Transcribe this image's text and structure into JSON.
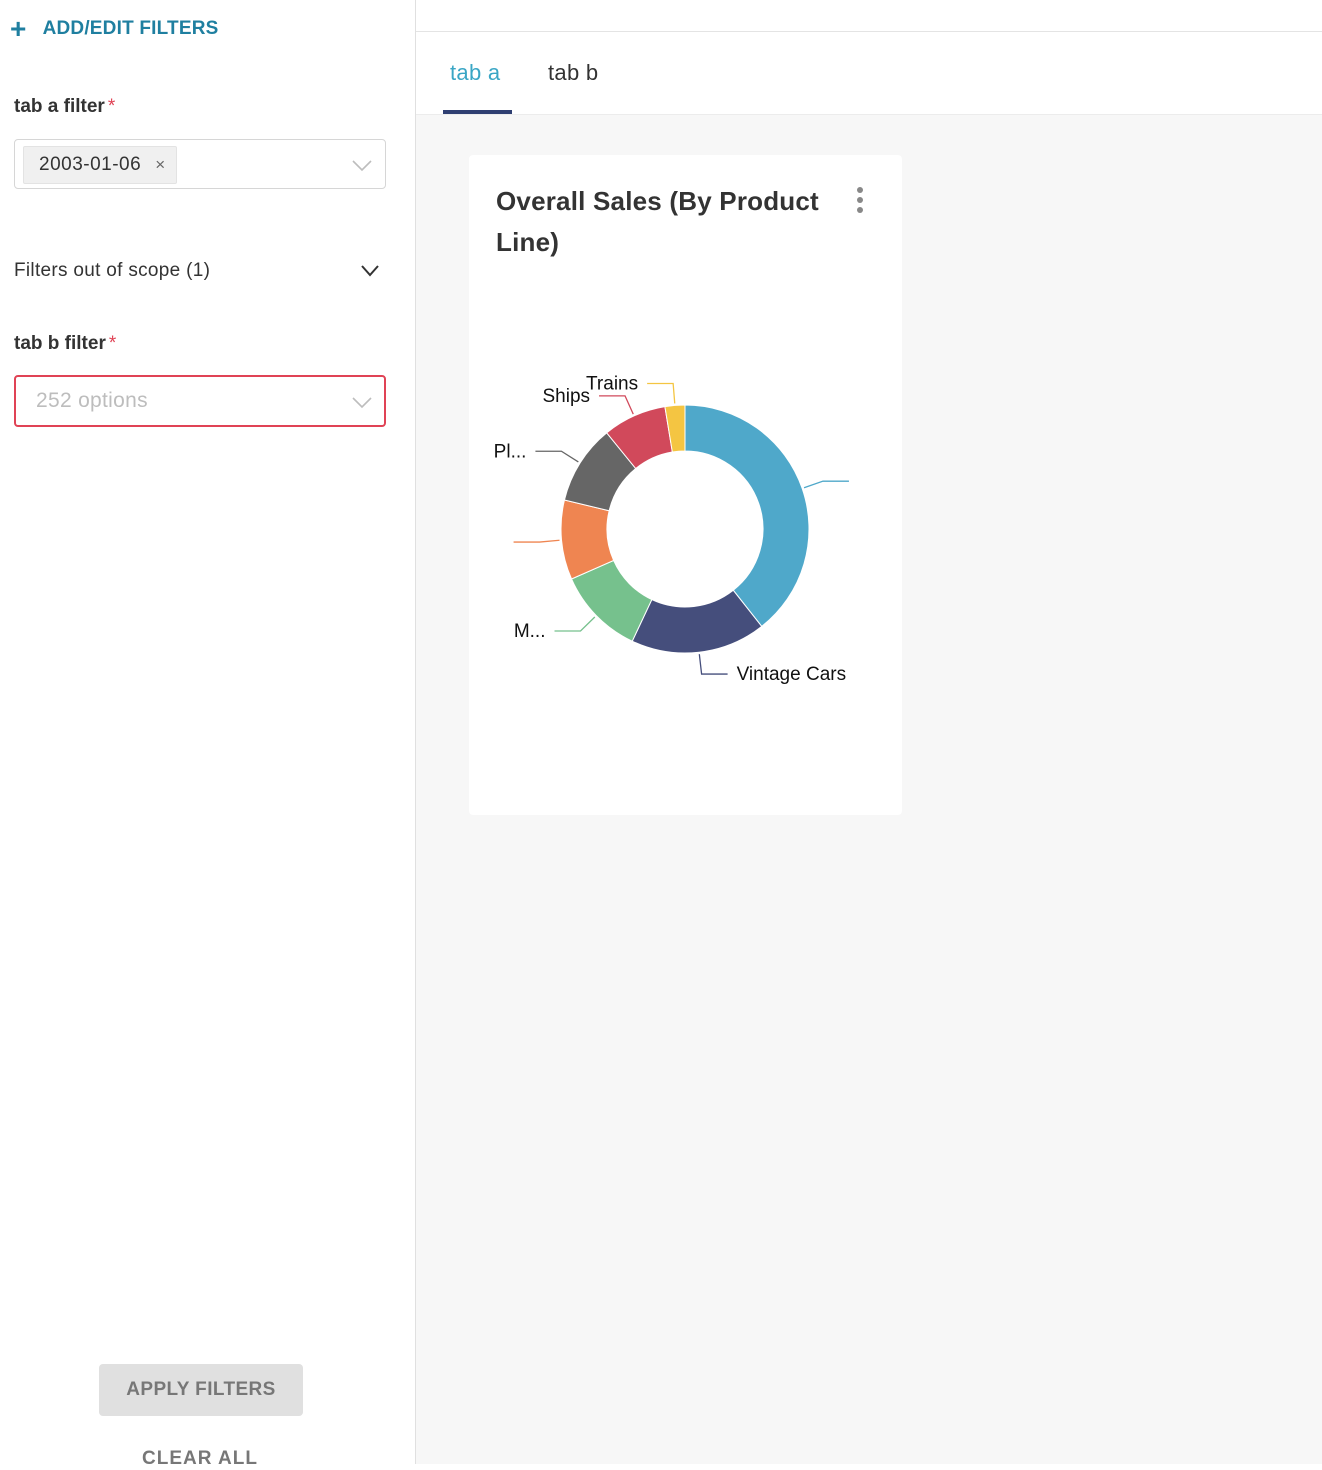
{
  "filter_panel": {
    "add_edit_label": "ADD/EDIT FILTERS",
    "tab_a_filter": {
      "label": "tab a filter",
      "required_mark": "*",
      "selected_tag": "2003-01-06",
      "remove_glyph": "×"
    },
    "scope": {
      "label": "Filters out of scope (1)"
    },
    "tab_b_filter": {
      "label": "tab b filter",
      "required_mark": "*",
      "placeholder": "252 options"
    },
    "apply_label": "APPLY FILTERS",
    "clear_label": "CLEAR ALL"
  },
  "dashboard": {
    "tabs": [
      {
        "label": "tab a",
        "active": true
      },
      {
        "label": "tab b",
        "active": false
      }
    ],
    "chart_card": {
      "title": "Overall Sales (By Product Line)"
    }
  },
  "chart_data": {
    "type": "pie",
    "title": "Overall Sales (By Product Line)",
    "donut": true,
    "slices": [
      {
        "label": "",
        "value": 38.0,
        "color": "#4fa8ca"
      },
      {
        "label": "Vintage Cars",
        "value": 17.0,
        "color": "#454e7c"
      },
      {
        "label": "M...",
        "value": 11.0,
        "color": "#76c18d"
      },
      {
        "label": "",
        "value": 10.0,
        "color": "#ef8551"
      },
      {
        "label": "Pl...",
        "value": 10.0,
        "color": "#666666"
      },
      {
        "label": "Ships",
        "value": 8.0,
        "color": "#d1495b"
      },
      {
        "label": "Trains",
        "value": 2.5,
        "color": "#f4c542"
      }
    ]
  }
}
